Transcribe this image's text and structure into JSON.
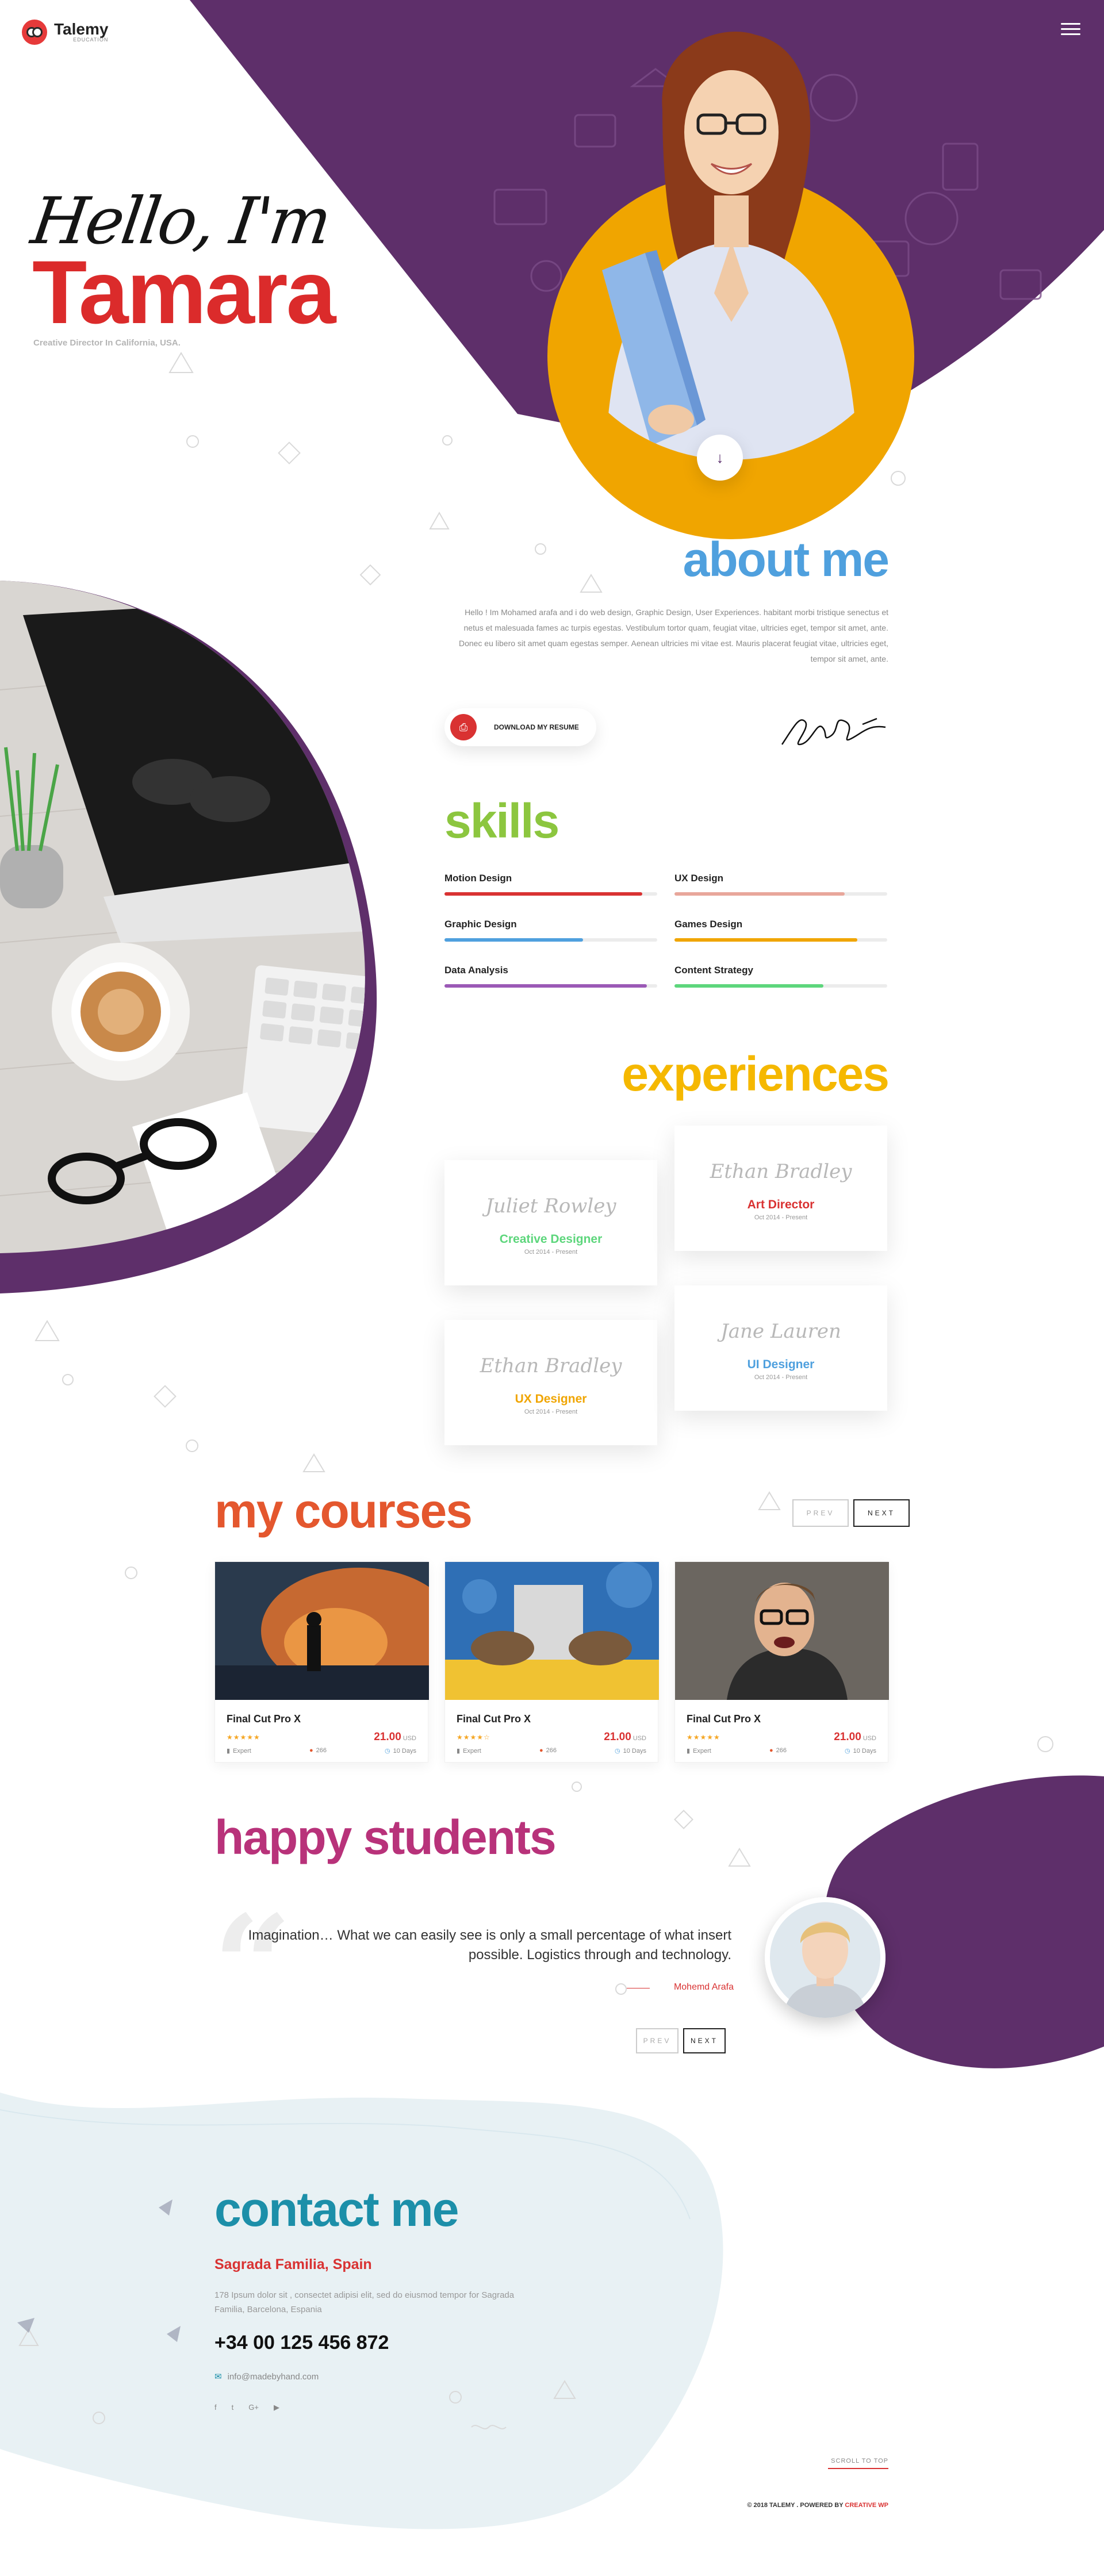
{
  "header": {
    "logo_text": "Talemy",
    "logo_sub": "EDUCATION"
  },
  "hero": {
    "greeting": "Hello, I'm",
    "name": "Tamara",
    "tagline": "Creative Director In California, USA."
  },
  "about": {
    "title": "about me",
    "text": "Hello ! Im Mohamed arafa and i do web design, Graphic Design, User Experiences. habitant morbi tristique senectus et netus et malesuada fames ac turpis egestas. Vestibulum tortor quam, feugiat vitae, ultricies eget, tempor sit amet, ante. Donec eu libero sit amet quam egestas semper. Aenean ultricies mi vitae est. Mauris placerat feugiat vitae, ultricies eget, tempor sit amet, ante.",
    "resume_button": "DOWNLOAD MY RESUME"
  },
  "skills": {
    "title": "skills",
    "items": [
      {
        "label": "Motion Design",
        "level": 0.93,
        "color": "#d93232"
      },
      {
        "label": "UX Design",
        "level": 0.8,
        "color": "#e8a79b"
      },
      {
        "label": "Graphic Design",
        "level": 0.65,
        "color": "#4fa0de"
      },
      {
        "label": "Games Design",
        "level": 0.86,
        "color": "#f0a500"
      },
      {
        "label": "Data Analysis",
        "level": 0.95,
        "color": "#9b59b6"
      },
      {
        "label": "Content Strategy",
        "level": 0.7,
        "color": "#5dd67c"
      }
    ]
  },
  "experiences": {
    "title": "experiences",
    "items": [
      {
        "logo": "Juliet Rowley",
        "role": "Creative Designer",
        "date": "Oct 2014 - Present",
        "color": "#5dd67c"
      },
      {
        "logo": "Ethan Bradley",
        "role": "Art Director",
        "date": "Oct 2014 - Present",
        "color": "#d93232"
      },
      {
        "logo": "Ethan Bradley",
        "role": "UX Designer",
        "date": "Oct 2014 - Present",
        "color": "#f0a500"
      },
      {
        "logo": "Jane Lauren",
        "role": "UI Designer",
        "date": "Oct 2014 - Present",
        "color": "#4fa0de"
      }
    ]
  },
  "courses": {
    "title": "my courses",
    "prev": "PREV",
    "next": "NEXT",
    "items": [
      {
        "name": "Final Cut Pro X",
        "stars": "★★★★★",
        "price": "21.00",
        "currency": "USD",
        "level": "Expert",
        "students": "266",
        "duration": "10 Days"
      },
      {
        "name": "Final Cut Pro X",
        "stars": "★★★★☆",
        "price": "21.00",
        "currency": "USD",
        "level": "Expert",
        "students": "266",
        "duration": "10 Days"
      },
      {
        "name": "Final Cut Pro X",
        "stars": "★★★★★",
        "price": "21.00",
        "currency": "USD",
        "level": "Expert",
        "students": "266",
        "duration": "10 Days"
      }
    ]
  },
  "students": {
    "title": "happy students",
    "quote": "Imagination… What we can easily see is only a small percentage of what insert possible. Logistics through and technology.",
    "author": "Mohemd Arafa",
    "prev": "PREV",
    "next": "NEXT"
  },
  "contact": {
    "title": "contact me",
    "city": "Sagrada Familia, Spain",
    "address": "178 Ipsum dolor sit , consectet adipisi elit, sed do eiusmod tempor for Sagrada Familia, Barcelona, Espania",
    "phone": "+34 00 125 456 872",
    "email": "info@madebyhand.com",
    "socials": [
      "f",
      "t",
      "G+",
      "▶"
    ]
  },
  "footer": {
    "scroll_top": "SCROLL TO TOP",
    "copyright_prefix": "© 2018 TALEMY . POWERED BY ",
    "copyright_brand": "CREATIVE WP"
  },
  "colors": {
    "purple": "#5e2f6a",
    "red": "#db2b2b",
    "yellow": "#f0a500"
  }
}
